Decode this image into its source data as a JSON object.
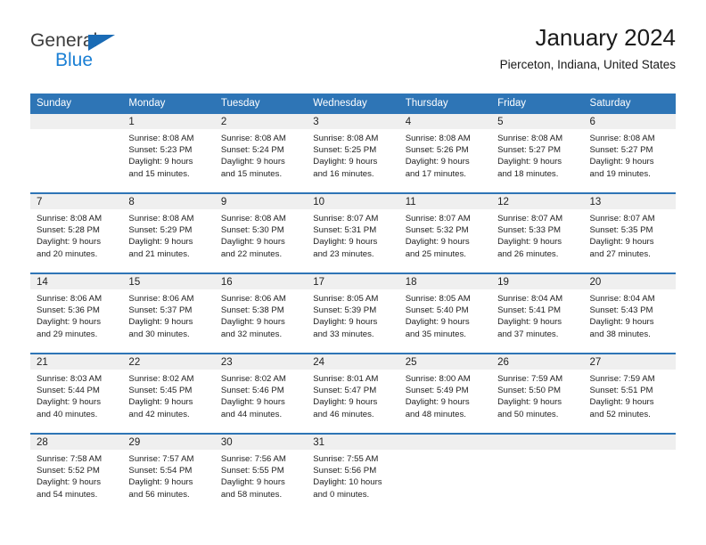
{
  "brand": {
    "line1": "General",
    "line2": "Blue",
    "triangle_color": "#1a6bb5",
    "blue_color": "#1a7fd4"
  },
  "header": {
    "title": "January 2024",
    "subtitle": "Pierceton, Indiana, United States",
    "accent_color": "#2E75B6",
    "datebar_color": "#EFEFEF"
  },
  "weekdays": [
    "Sunday",
    "Monday",
    "Tuesday",
    "Wednesday",
    "Thursday",
    "Friday",
    "Saturday"
  ],
  "weeks": [
    [
      {
        "day": "",
        "sunrise": "",
        "sunset": "",
        "daylight_line1": "",
        "daylight_line2": ""
      },
      {
        "day": "1",
        "sunrise": "Sunrise: 8:08 AM",
        "sunset": "Sunset: 5:23 PM",
        "daylight_line1": "Daylight: 9 hours",
        "daylight_line2": "and 15 minutes."
      },
      {
        "day": "2",
        "sunrise": "Sunrise: 8:08 AM",
        "sunset": "Sunset: 5:24 PM",
        "daylight_line1": "Daylight: 9 hours",
        "daylight_line2": "and 15 minutes."
      },
      {
        "day": "3",
        "sunrise": "Sunrise: 8:08 AM",
        "sunset": "Sunset: 5:25 PM",
        "daylight_line1": "Daylight: 9 hours",
        "daylight_line2": "and 16 minutes."
      },
      {
        "day": "4",
        "sunrise": "Sunrise: 8:08 AM",
        "sunset": "Sunset: 5:26 PM",
        "daylight_line1": "Daylight: 9 hours",
        "daylight_line2": "and 17 minutes."
      },
      {
        "day": "5",
        "sunrise": "Sunrise: 8:08 AM",
        "sunset": "Sunset: 5:27 PM",
        "daylight_line1": "Daylight: 9 hours",
        "daylight_line2": "and 18 minutes."
      },
      {
        "day": "6",
        "sunrise": "Sunrise: 8:08 AM",
        "sunset": "Sunset: 5:27 PM",
        "daylight_line1": "Daylight: 9 hours",
        "daylight_line2": "and 19 minutes."
      }
    ],
    [
      {
        "day": "7",
        "sunrise": "Sunrise: 8:08 AM",
        "sunset": "Sunset: 5:28 PM",
        "daylight_line1": "Daylight: 9 hours",
        "daylight_line2": "and 20 minutes."
      },
      {
        "day": "8",
        "sunrise": "Sunrise: 8:08 AM",
        "sunset": "Sunset: 5:29 PM",
        "daylight_line1": "Daylight: 9 hours",
        "daylight_line2": "and 21 minutes."
      },
      {
        "day": "9",
        "sunrise": "Sunrise: 8:08 AM",
        "sunset": "Sunset: 5:30 PM",
        "daylight_line1": "Daylight: 9 hours",
        "daylight_line2": "and 22 minutes."
      },
      {
        "day": "10",
        "sunrise": "Sunrise: 8:07 AM",
        "sunset": "Sunset: 5:31 PM",
        "daylight_line1": "Daylight: 9 hours",
        "daylight_line2": "and 23 minutes."
      },
      {
        "day": "11",
        "sunrise": "Sunrise: 8:07 AM",
        "sunset": "Sunset: 5:32 PM",
        "daylight_line1": "Daylight: 9 hours",
        "daylight_line2": "and 25 minutes."
      },
      {
        "day": "12",
        "sunrise": "Sunrise: 8:07 AM",
        "sunset": "Sunset: 5:33 PM",
        "daylight_line1": "Daylight: 9 hours",
        "daylight_line2": "and 26 minutes."
      },
      {
        "day": "13",
        "sunrise": "Sunrise: 8:07 AM",
        "sunset": "Sunset: 5:35 PM",
        "daylight_line1": "Daylight: 9 hours",
        "daylight_line2": "and 27 minutes."
      }
    ],
    [
      {
        "day": "14",
        "sunrise": "Sunrise: 8:06 AM",
        "sunset": "Sunset: 5:36 PM",
        "daylight_line1": "Daylight: 9 hours",
        "daylight_line2": "and 29 minutes."
      },
      {
        "day": "15",
        "sunrise": "Sunrise: 8:06 AM",
        "sunset": "Sunset: 5:37 PM",
        "daylight_line1": "Daylight: 9 hours",
        "daylight_line2": "and 30 minutes."
      },
      {
        "day": "16",
        "sunrise": "Sunrise: 8:06 AM",
        "sunset": "Sunset: 5:38 PM",
        "daylight_line1": "Daylight: 9 hours",
        "daylight_line2": "and 32 minutes."
      },
      {
        "day": "17",
        "sunrise": "Sunrise: 8:05 AM",
        "sunset": "Sunset: 5:39 PM",
        "daylight_line1": "Daylight: 9 hours",
        "daylight_line2": "and 33 minutes."
      },
      {
        "day": "18",
        "sunrise": "Sunrise: 8:05 AM",
        "sunset": "Sunset: 5:40 PM",
        "daylight_line1": "Daylight: 9 hours",
        "daylight_line2": "and 35 minutes."
      },
      {
        "day": "19",
        "sunrise": "Sunrise: 8:04 AM",
        "sunset": "Sunset: 5:41 PM",
        "daylight_line1": "Daylight: 9 hours",
        "daylight_line2": "and 37 minutes."
      },
      {
        "day": "20",
        "sunrise": "Sunrise: 8:04 AM",
        "sunset": "Sunset: 5:43 PM",
        "daylight_line1": "Daylight: 9 hours",
        "daylight_line2": "and 38 minutes."
      }
    ],
    [
      {
        "day": "21",
        "sunrise": "Sunrise: 8:03 AM",
        "sunset": "Sunset: 5:44 PM",
        "daylight_line1": "Daylight: 9 hours",
        "daylight_line2": "and 40 minutes."
      },
      {
        "day": "22",
        "sunrise": "Sunrise: 8:02 AM",
        "sunset": "Sunset: 5:45 PM",
        "daylight_line1": "Daylight: 9 hours",
        "daylight_line2": "and 42 minutes."
      },
      {
        "day": "23",
        "sunrise": "Sunrise: 8:02 AM",
        "sunset": "Sunset: 5:46 PM",
        "daylight_line1": "Daylight: 9 hours",
        "daylight_line2": "and 44 minutes."
      },
      {
        "day": "24",
        "sunrise": "Sunrise: 8:01 AM",
        "sunset": "Sunset: 5:47 PM",
        "daylight_line1": "Daylight: 9 hours",
        "daylight_line2": "and 46 minutes."
      },
      {
        "day": "25",
        "sunrise": "Sunrise: 8:00 AM",
        "sunset": "Sunset: 5:49 PM",
        "daylight_line1": "Daylight: 9 hours",
        "daylight_line2": "and 48 minutes."
      },
      {
        "day": "26",
        "sunrise": "Sunrise: 7:59 AM",
        "sunset": "Sunset: 5:50 PM",
        "daylight_line1": "Daylight: 9 hours",
        "daylight_line2": "and 50 minutes."
      },
      {
        "day": "27",
        "sunrise": "Sunrise: 7:59 AM",
        "sunset": "Sunset: 5:51 PM",
        "daylight_line1": "Daylight: 9 hours",
        "daylight_line2": "and 52 minutes."
      }
    ],
    [
      {
        "day": "28",
        "sunrise": "Sunrise: 7:58 AM",
        "sunset": "Sunset: 5:52 PM",
        "daylight_line1": "Daylight: 9 hours",
        "daylight_line2": "and 54 minutes."
      },
      {
        "day": "29",
        "sunrise": "Sunrise: 7:57 AM",
        "sunset": "Sunset: 5:54 PM",
        "daylight_line1": "Daylight: 9 hours",
        "daylight_line2": "and 56 minutes."
      },
      {
        "day": "30",
        "sunrise": "Sunrise: 7:56 AM",
        "sunset": "Sunset: 5:55 PM",
        "daylight_line1": "Daylight: 9 hours",
        "daylight_line2": "and 58 minutes."
      },
      {
        "day": "31",
        "sunrise": "Sunrise: 7:55 AM",
        "sunset": "Sunset: 5:56 PM",
        "daylight_line1": "Daylight: 10 hours",
        "daylight_line2": "and 0 minutes."
      },
      {
        "day": "",
        "sunrise": "",
        "sunset": "",
        "daylight_line1": "",
        "daylight_line2": ""
      },
      {
        "day": "",
        "sunrise": "",
        "sunset": "",
        "daylight_line1": "",
        "daylight_line2": ""
      },
      {
        "day": "",
        "sunrise": "",
        "sunset": "",
        "daylight_line1": "",
        "daylight_line2": ""
      }
    ]
  ]
}
